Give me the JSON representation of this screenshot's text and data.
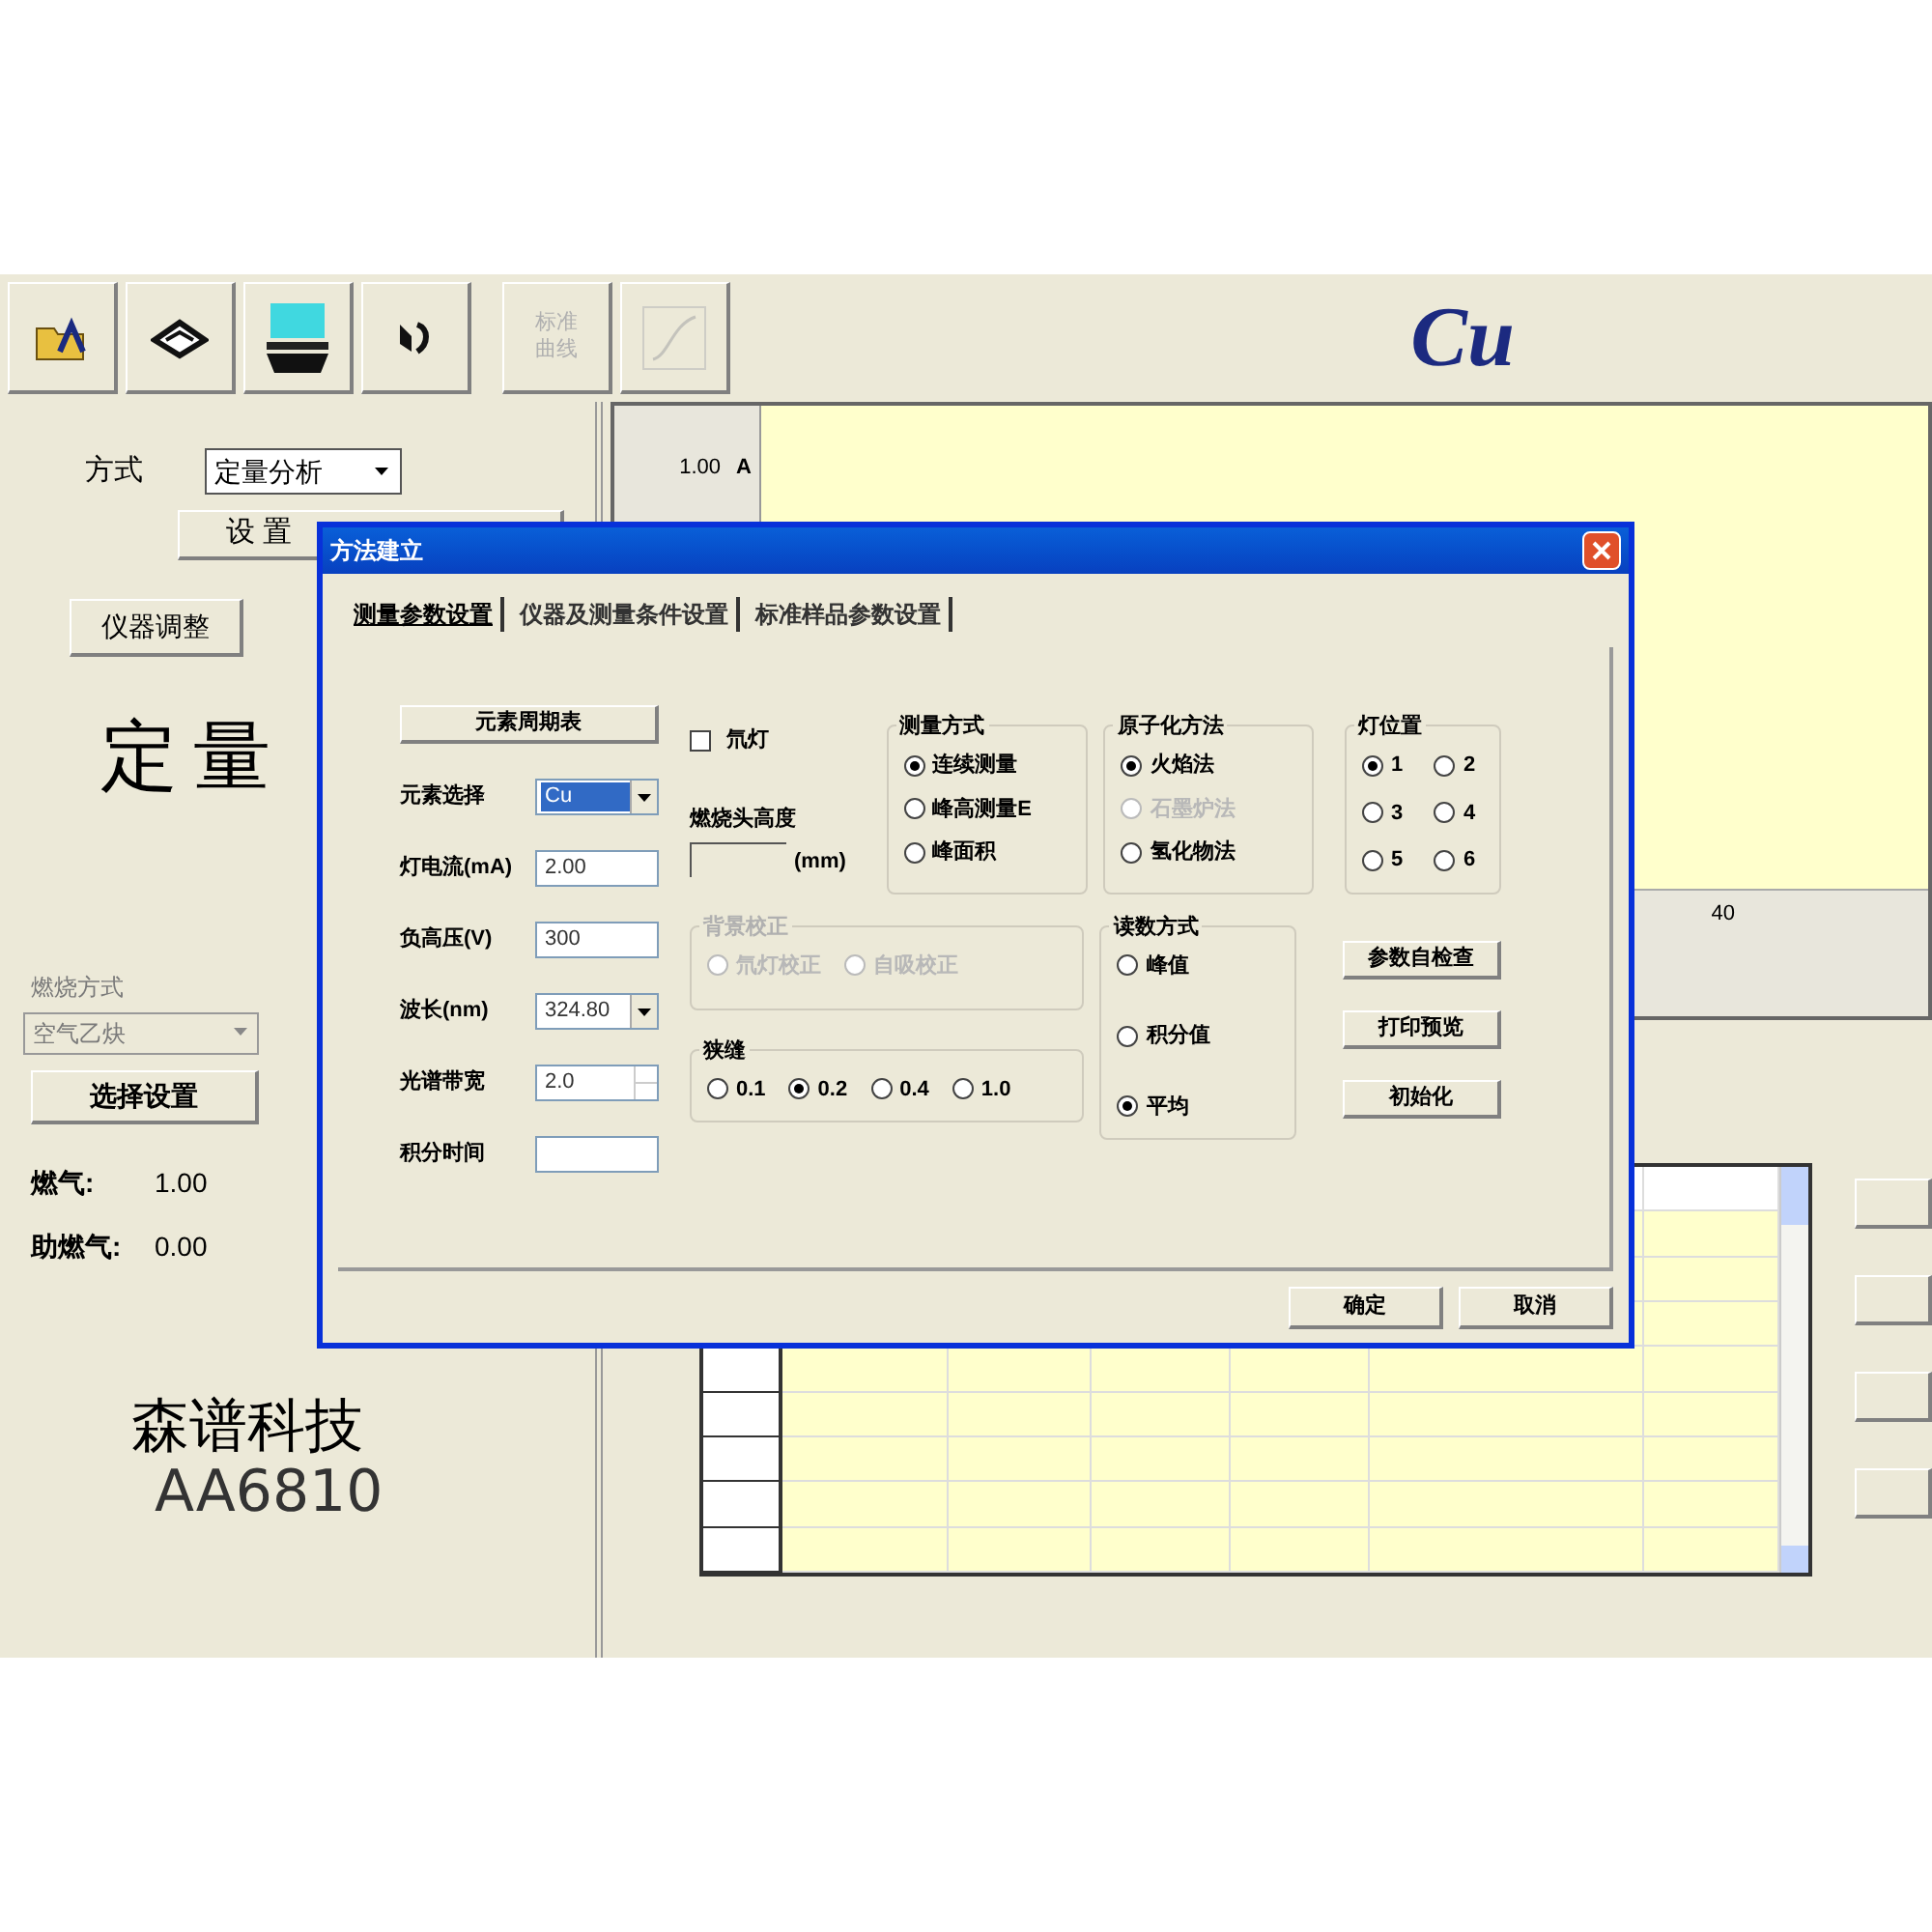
{
  "toolbar": [
    {
      "disabled": false
    },
    {
      "disabled": false
    },
    {
      "disabled": false
    },
    {
      "disabled": false
    },
    {
      "label": "标准曲线",
      "disabled": true
    },
    {
      "disabled": true
    }
  ],
  "element_title": "Cu",
  "left_panel": {
    "mode_label": "方式",
    "mode_value": "定量分析",
    "settings_button": "设 置",
    "instrument_button": "仪器调整",
    "big_label": "定量",
    "gas_label": "燃烧方式",
    "gas_value": "空气乙炔",
    "gas_disabled": true,
    "select_button": "选择设置",
    "readings": [
      {
        "label": "燃气:",
        "value": "1.00"
      },
      {
        "label": "助燃气:",
        "value": "0.00"
      }
    ],
    "brand": "森谱科技",
    "model": "AA6810"
  },
  "chart": {
    "y_max": "1.00",
    "y_unit": "A",
    "x_tick": "40"
  },
  "dialog": {
    "title": "方法建立",
    "tabs": [
      {
        "label": "测量参数设置",
        "selected": true
      },
      {
        "label": "仪器及测量条件设置",
        "selected": false
      },
      {
        "label": "标准样品参数设置",
        "selected": false
      }
    ],
    "periodic_button": "元素周期表",
    "fields": [
      {
        "label": "元素选择",
        "value": "Cu",
        "kind": "select",
        "selected": true
      },
      {
        "label": "灯电流(mA)",
        "value": "2.00",
        "kind": "input",
        "selected": false
      },
      {
        "label": "负高压(V)",
        "value": "300",
        "kind": "input",
        "selected": false
      },
      {
        "label": "波长(nm)",
        "value": "324.80",
        "kind": "select",
        "selected": false
      },
      {
        "label": "光谱带宽",
        "value": "2.0",
        "kind": "spin",
        "selected": false
      },
      {
        "label": "积分时间",
        "kind": "input",
        "selected": false
      }
    ],
    "checkbox": {
      "label": "氘灯",
      "checked": false
    },
    "burner": {
      "label": "燃烧头高度",
      "unit": "(mm)"
    },
    "groups": [
      {
        "title": "测量方式",
        "disabled": false,
        "options": [
          {
            "label": "连续测量",
            "selected": true
          },
          {
            "label": "峰高测量E",
            "selected": false
          },
          {
            "label": "峰面积",
            "selected": false
          }
        ]
      },
      {
        "title": "原子化方法",
        "disabled": false,
        "options": [
          {
            "label": "火焰法",
            "selected": true
          },
          {
            "label": "石墨炉法",
            "selected": false,
            "disabled": true
          },
          {
            "label": "氢化物法",
            "selected": false,
            "disabled": false
          }
        ]
      },
      {
        "title": "灯位置",
        "disabled": false,
        "options": [
          {
            "label": "1",
            "selected": true
          },
          {
            "label": "2",
            "selected": false
          },
          {
            "label": "3",
            "selected": false
          },
          {
            "label": "4",
            "selected": false
          },
          {
            "label": "5",
            "selected": false
          },
          {
            "label": "6",
            "selected": false
          }
        ]
      },
      {
        "title": "背景校正",
        "disabled": true,
        "options": [
          {
            "label": "氘灯校正",
            "selected": false
          },
          {
            "label": "自吸校正",
            "selected": false
          }
        ]
      },
      {
        "title": "狭缝",
        "disabled": false,
        "options": [
          {
            "label": "0.1",
            "selected": false
          },
          {
            "label": "0.2",
            "selected": true
          },
          {
            "label": "0.4",
            "selected": false
          },
          {
            "label": "1.0",
            "selected": false
          }
        ]
      },
      {
        "title": "读数方式",
        "disabled": false,
        "options": [
          {
            "label": "峰值",
            "selected": false
          },
          {
            "label": "积分值",
            "selected": false
          },
          {
            "label": "平均",
            "selected": true
          }
        ]
      }
    ],
    "side_buttons": [
      "参数自检查",
      "打印预览",
      "初始化"
    ],
    "footer_buttons": [
      "确定",
      "取消"
    ]
  }
}
